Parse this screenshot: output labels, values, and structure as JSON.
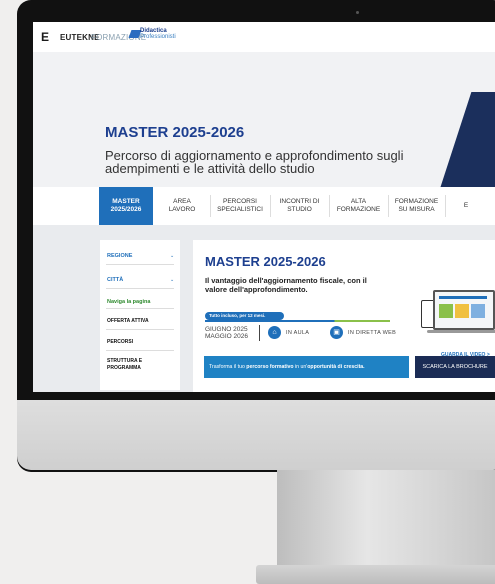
{
  "header": {
    "logo_mark": "E",
    "brand_bold": "EUTEKNE",
    "brand_light": "FORMAZIONE",
    "partner_line1": "Didactica",
    "partner_line2": "Professionisti"
  },
  "hero": {
    "title": "MASTER 2025-2026",
    "subtitle": "Percorso di aggiornamento e approfondimento sugli adempimenti e le attività dello studio"
  },
  "nav": {
    "items": [
      {
        "line1": "MASTER",
        "line2": "2025/2026",
        "active": true
      },
      {
        "line1": "AREA",
        "line2": "LAVORO",
        "active": false
      },
      {
        "line1": "PERCORSI",
        "line2": "SPECIALISTICI",
        "active": false
      },
      {
        "line1": "INCONTRI DI",
        "line2": "STUDIO",
        "active": false
      },
      {
        "line1": "ALTA",
        "line2": "FORMAZIONE",
        "active": false
      },
      {
        "line1": "FORMAZIONE",
        "line2": "SU MISURA",
        "active": false
      },
      {
        "line1": "E",
        "line2": "",
        "active": false
      }
    ]
  },
  "sidebar": {
    "regione": "REGIONE",
    "citta": "CITTÀ",
    "naviga": "Naviga la pagina",
    "links": [
      "OFFERTA ATTIVA",
      "PERCORSI",
      "STRUTTURA E PROGRAMMA"
    ]
  },
  "card": {
    "title": "MASTER 2025-2026",
    "tagline": "Il vantaggio dell'aggiornamento fiscale, con il valore dell'approfondimento.",
    "pill": "Tutto incluso, per 12 mesi.",
    "date_line1": "GIUGNO 2025",
    "date_line2": "MAGGIO 2026",
    "mode_in_aula": "IN AULA",
    "mode_diretta": "IN DIRETTA WEB",
    "video_link": "GUARDA IL VIDEO >",
    "banner_pre": "Trasforma il tuo ",
    "banner_b1": "percorso formativo",
    "banner_mid": " in un'",
    "banner_b2": "opportunità di crescita.",
    "brochure_button": "SCARICA LA BROCHURE"
  },
  "colors": {
    "primary_blue": "#1f6fba",
    "navy": "#1b2c55",
    "title_blue": "#1d3f8f",
    "green": "#8ac04a"
  },
  "icons": [
    "classroom-icon",
    "live-web-icon",
    "edit-pen-icon"
  ]
}
